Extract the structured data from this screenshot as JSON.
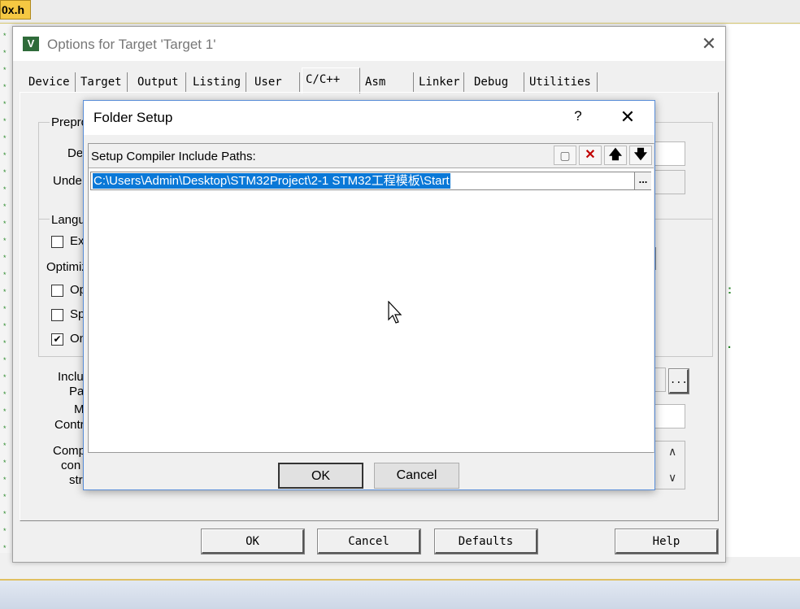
{
  "editor": {
    "tab_label": "0x.h",
    "gutter_marks": [
      "*",
      "*",
      "*",
      "*",
      "*",
      "*",
      "*",
      "*",
      "*",
      "*",
      "*",
      "*",
      "*",
      "*",
      "*",
      "*",
      "*",
      "*",
      "*",
      "*",
      "*",
      "*",
      "*",
      "*",
      "*",
      "*",
      "*",
      "*",
      "*",
      "*",
      "*"
    ],
    "right_marks": [
      ":",
      "."
    ]
  },
  "options_dialog": {
    "title": "Options for Target 'Target 1'",
    "close": "✕",
    "tabs": [
      "Device",
      "Target",
      "Output",
      "Listing",
      "User",
      "C/C++",
      "Asm",
      "Linker",
      "Debug",
      "Utilities"
    ],
    "active_tab": "C/C++",
    "preprocessor_group": "Prepro",
    "define_label": "De",
    "undefine_label": "Unde",
    "language_group": "Langu",
    "language_check": "Ex",
    "optimization_label": "Optimiz",
    "opt_checks": [
      {
        "label": "Op",
        "checked": false
      },
      {
        "label": "Sp",
        "checked": false
      },
      {
        "label": "On",
        "checked": true
      }
    ],
    "include_label": "Inclu",
    "paths_label": "Pa",
    "misc_label": "M",
    "controls_label": "Contr",
    "compiler_label": "Comp",
    "compiler_label2": "con",
    "compiler_label3": "str",
    "browse": "...",
    "scroll_up": "∧",
    "scroll_down": "∨",
    "buttons": {
      "ok": "OK",
      "cancel": "Cancel",
      "defaults": "Defaults",
      "help": "Help"
    }
  },
  "folder_setup": {
    "title": "Folder Setup",
    "help": "?",
    "close": "✕",
    "list_header": "Setup Compiler Include Paths:",
    "toolbar": {
      "new": "▢",
      "delete": "✕",
      "up": "🡅",
      "down": "🡇"
    },
    "paths": [
      "C:\\Users\\Admin\\Desktop\\STM32Project\\2-1 STM32工程模板\\Start"
    ],
    "browse": "...",
    "ok": "OK",
    "cancel": "Cancel"
  }
}
